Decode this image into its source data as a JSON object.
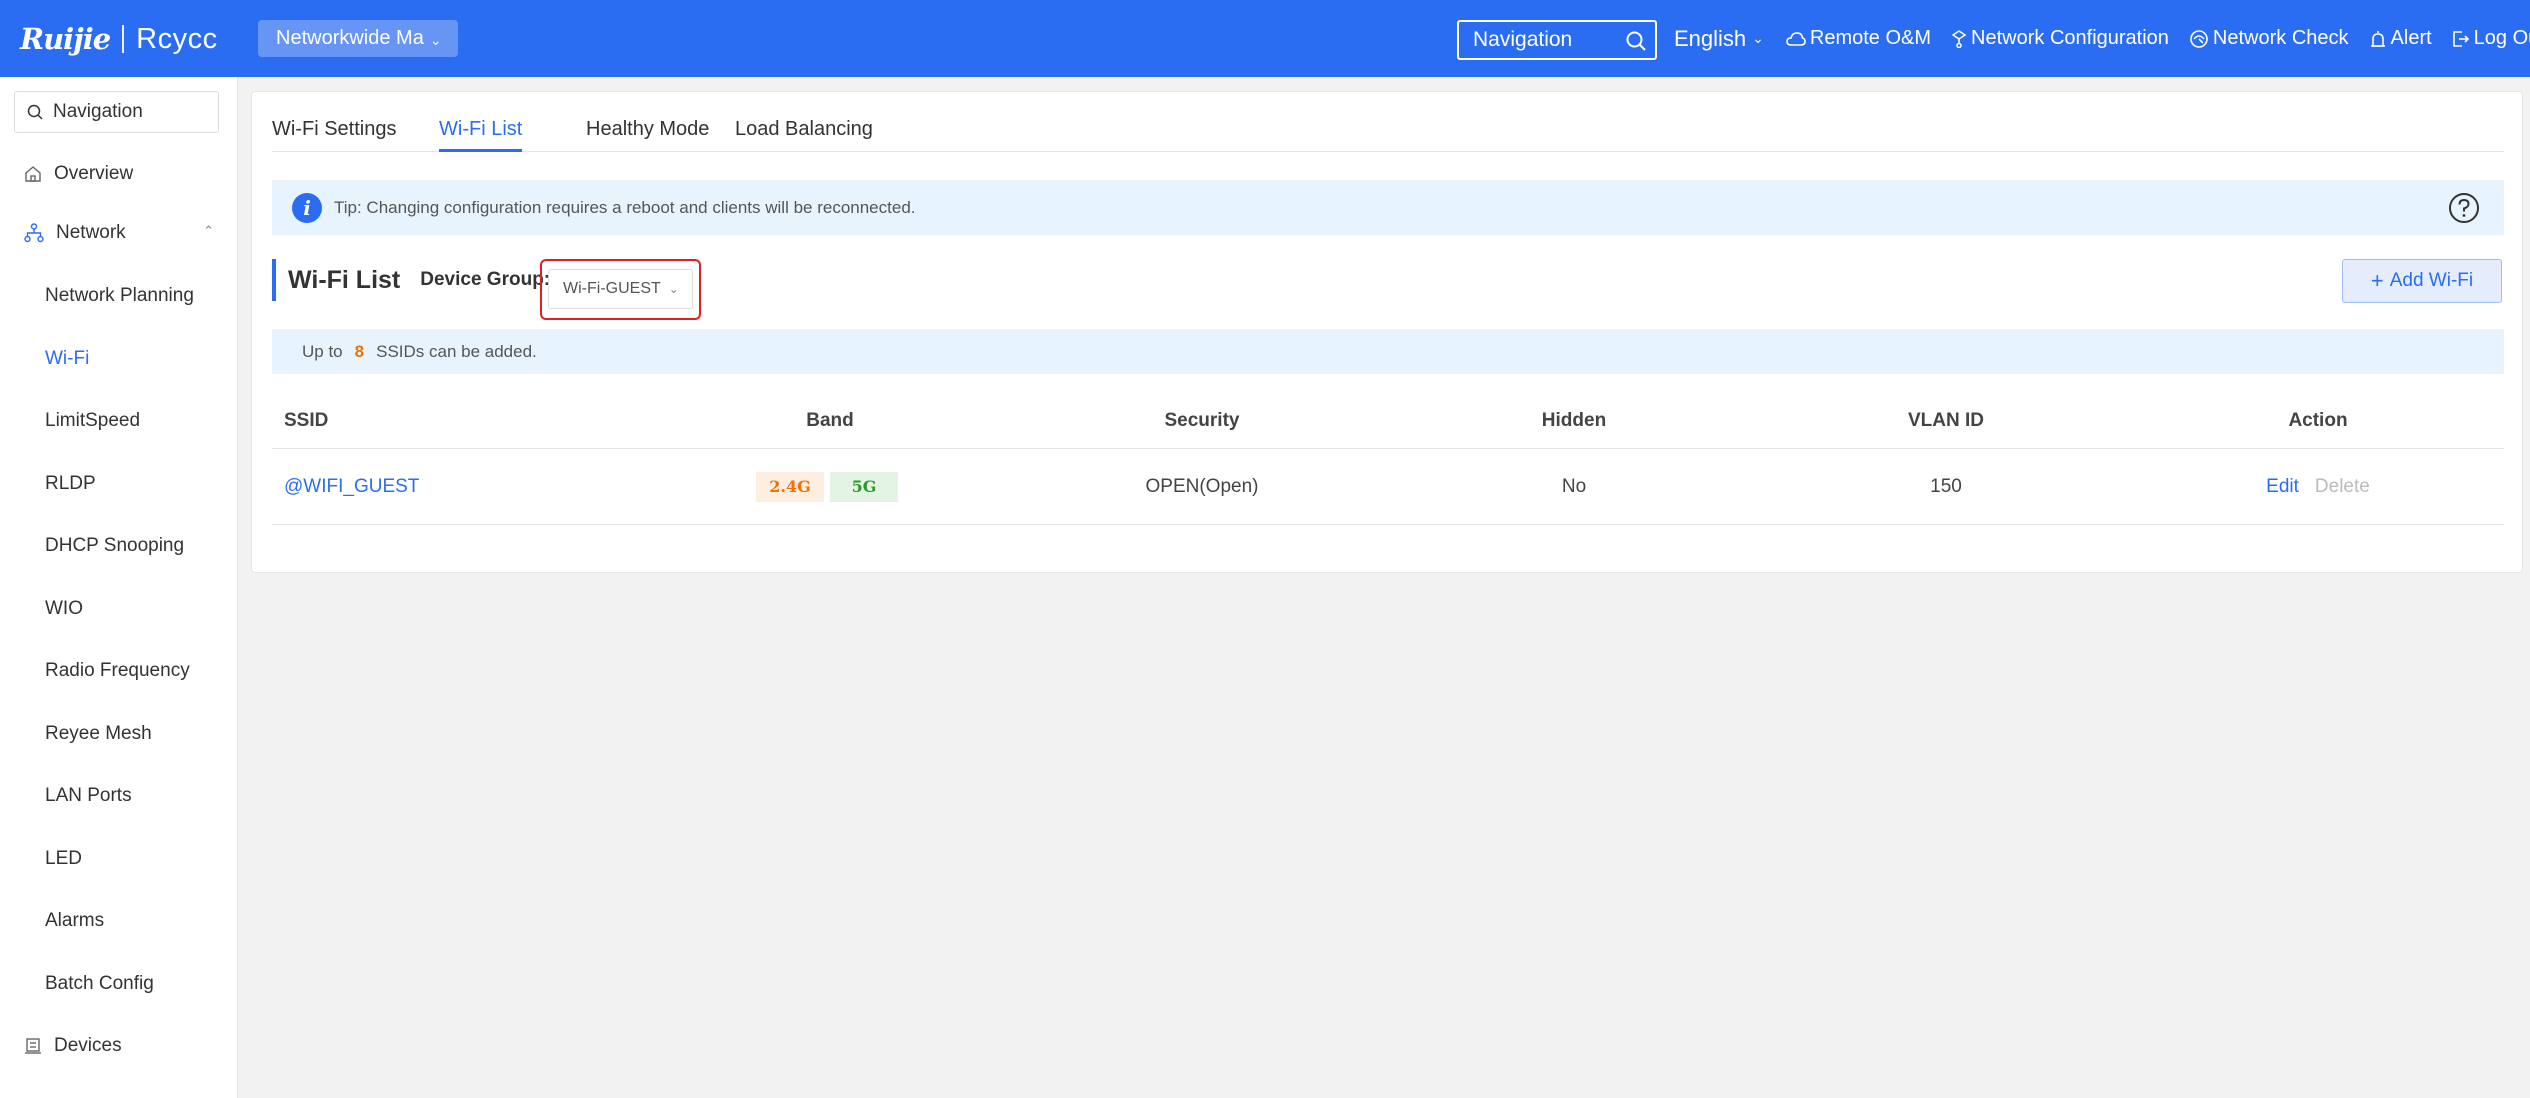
{
  "header": {
    "logo_brand": "Ruijie",
    "logo_product": "Rcycc",
    "project": "Networkwide Ma",
    "search_placeholder": "Navigation",
    "language": "English",
    "items": [
      {
        "label": "Remote O&M",
        "icon": "cloud-icon"
      },
      {
        "label": "Network Configuration",
        "icon": "network-config-icon"
      },
      {
        "label": "Network Check",
        "icon": "network-check-icon"
      },
      {
        "label": "Alert",
        "icon": "alert-icon"
      },
      {
        "label": "Log Out",
        "icon": "logout-icon"
      }
    ]
  },
  "sidebar": {
    "search_placeholder": "Navigation",
    "overview": "Overview",
    "network": "Network",
    "sub_items": [
      "Network Planning",
      "Wi-Fi",
      "LimitSpeed",
      "RLDP",
      "DHCP Snooping",
      "WIO",
      "Radio Frequency",
      "Reyee Mesh",
      "LAN Ports",
      "LED",
      "Alarms",
      "Batch Config"
    ],
    "active_sub": "Wi-Fi",
    "devices": "Devices"
  },
  "tabs": [
    "Wi-Fi Settings",
    "Wi-Fi List",
    "Healthy Mode",
    "Load Balancing"
  ],
  "active_tab": "Wi-Fi List",
  "tip": "Tip: Changing configuration requires a reboot and clients will be reconnected.",
  "wifi_list": {
    "title": "Wi-Fi List",
    "device_group_label": "Device Group:",
    "device_group_value": "Wi-Fi-GUEST",
    "add_button": "Add Wi-Fi",
    "limit_prefix": "Up to",
    "limit_count": "8",
    "limit_suffix": "SSIDs can be added."
  },
  "table": {
    "columns": [
      "SSID",
      "Band",
      "Security",
      "Hidden",
      "VLAN ID",
      "Action"
    ],
    "rows": [
      {
        "ssid": "@WIFI_GUEST",
        "bands": [
          "2.4G",
          "5G"
        ],
        "security": "OPEN(Open)",
        "hidden": "No",
        "vlan": "150",
        "edit": "Edit",
        "delete": "Delete"
      }
    ]
  },
  "colors": {
    "primary": "#2b6df2",
    "band_24": "#f07000",
    "band_5": "#2a9a2a",
    "highlight": "#e02020"
  }
}
